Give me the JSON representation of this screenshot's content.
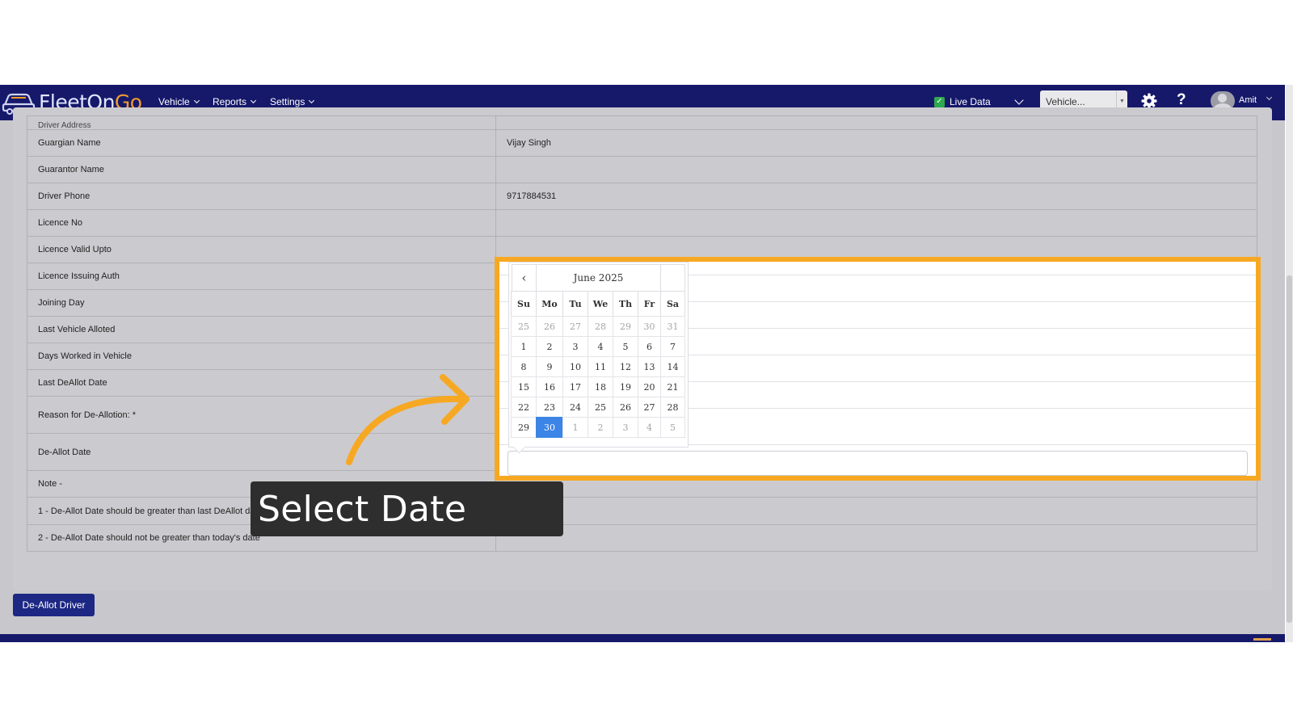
{
  "app": {
    "brand_fleet": "FleetOn",
    "brand_go": "Go",
    "nav": [
      "Vehicle",
      "Reports",
      "Settings"
    ],
    "live_data_label": "Live Data",
    "live_data_checked": true,
    "vehicle_select_placeholder": "Vehicle...",
    "user_name": "Amit",
    "help_label": "?"
  },
  "colors": {
    "navbar": "#16196a",
    "highlight_border": "#f7a823",
    "selected_day": "#3c84e6",
    "button": "#1d2784",
    "tooltip_bg": "#2e2e2e"
  },
  "icons": [
    "car-logo-icon",
    "gear-icon",
    "help-icon",
    "avatar-icon",
    "chevron-down-icon",
    "check-icon",
    "arrow-annotation-icon"
  ],
  "table": {
    "partial_label": "Driver Address",
    "rows": [
      {
        "label": "Guargian Name",
        "value": "Vijay Singh"
      },
      {
        "label": "Guarantor Name",
        "value": ""
      },
      {
        "label": "Driver Phone",
        "value": "9717884531"
      },
      {
        "label": "Licence No",
        "value": ""
      },
      {
        "label": "Licence Valid Upto",
        "value": ""
      },
      {
        "label": "Licence Issuing Auth",
        "value": ""
      },
      {
        "label": "Joining Day",
        "value": ""
      },
      {
        "label": "Last Vehicle Alloted",
        "value": ""
      },
      {
        "label": "Days Worked in Vehicle",
        "value": ""
      },
      {
        "label": "Last DeAllot Date",
        "value": ""
      },
      {
        "label": "Reason for De-Allotion: *",
        "value": ""
      },
      {
        "label": "De-Allot Date",
        "value": ""
      },
      {
        "label": "Note -",
        "value": ""
      },
      {
        "label": "1 - De-Allot Date should be greater than last DeAllot date",
        "value": ""
      },
      {
        "label": "2 - De-Allot Date should not be greater than today's date",
        "value": ""
      }
    ]
  },
  "calendar": {
    "month_label": "June 2025",
    "prev_label": "‹",
    "weekdays": [
      "Su",
      "Mo",
      "Tu",
      "We",
      "Th",
      "Fr",
      "Sa"
    ],
    "weeks": [
      [
        25,
        26,
        27,
        28,
        29,
        30,
        31
      ],
      [
        1,
        2,
        3,
        4,
        5,
        6,
        7
      ],
      [
        8,
        9,
        10,
        11,
        12,
        13,
        14
      ],
      [
        15,
        16,
        17,
        18,
        19,
        20,
        21
      ],
      [
        22,
        23,
        24,
        25,
        26,
        27,
        28
      ],
      [
        29,
        30,
        1,
        2,
        3,
        4,
        5
      ]
    ],
    "selected_day": 30
  },
  "action_button_label": "De-Allot Driver",
  "annotation": {
    "tooltip_text": "Select Date"
  }
}
